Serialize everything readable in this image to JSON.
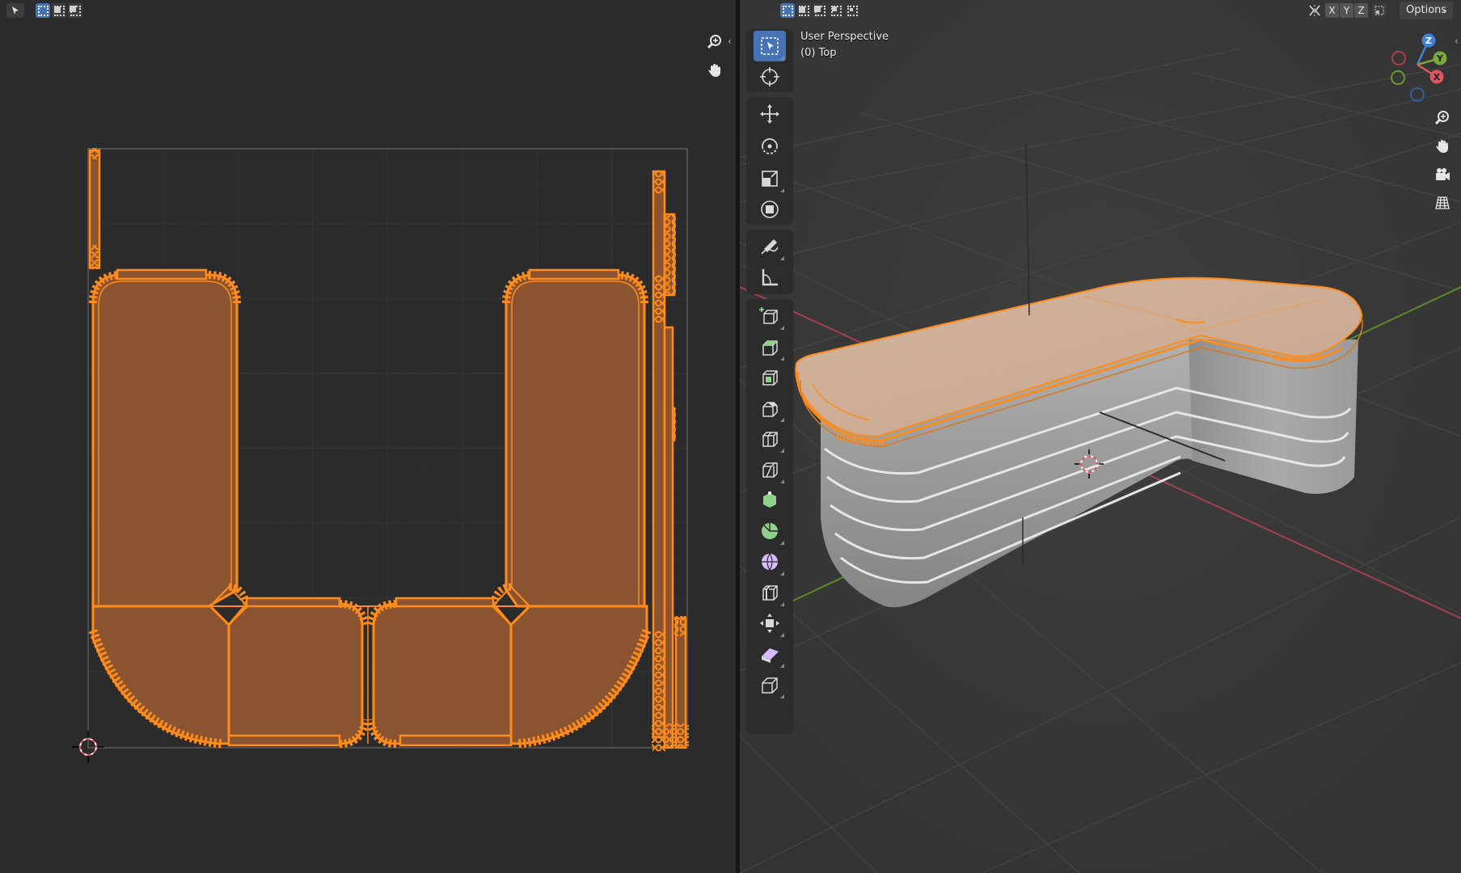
{
  "uv_editor": {
    "header": {
      "select_mode_icons": [
        "select-box-icon",
        "extend-selection-icon",
        "subtract-selection-icon"
      ]
    },
    "nav_icons": [
      "zoom-icon",
      "pan-hand-icon"
    ]
  },
  "viewport": {
    "view_label": "User Perspective",
    "collection_label": "(0) Top",
    "header": {
      "axis_x": "X",
      "axis_y": "Y",
      "axis_z": "Z",
      "options_label": "Options"
    },
    "gizmo_labels": {
      "z": "Z",
      "y": "Y",
      "x": "X"
    },
    "toolbar": [
      "select-box",
      "cursor",
      "move",
      "rotate",
      "scale",
      "transform",
      "annotate",
      "measure",
      "add-cube",
      "extrude-region",
      "inset-faces",
      "bevel",
      "loop-cut",
      "knife",
      "poly-build",
      "spin",
      "smooth",
      "edge-slide",
      "shrink-fatten",
      "shear",
      "rip-region"
    ],
    "nav_icons": [
      "zoom-icon",
      "pan-hand-icon",
      "camera-icon",
      "grid-toggle-icon"
    ]
  },
  "colors": {
    "selection_orange": "#ff8c1a",
    "face_fill": "#8b5430",
    "active_blue": "#4772b3",
    "axis_red": "#e05663",
    "axis_green": "#7aa83c",
    "axis_blue": "#3f82d8"
  }
}
